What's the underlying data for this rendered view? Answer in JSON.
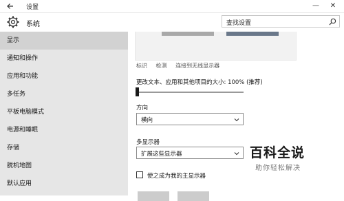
{
  "window": {
    "title": "设置"
  },
  "header": {
    "title": "系统",
    "search_placeholder": "查找设置"
  },
  "sidebar": {
    "items": [
      {
        "label": "显示",
        "selected": true
      },
      {
        "label": "通知和操作",
        "selected": false
      },
      {
        "label": "应用和功能",
        "selected": false
      },
      {
        "label": "多任务",
        "selected": false
      },
      {
        "label": "平板电脑模式",
        "selected": false
      },
      {
        "label": "电源和睡眠",
        "selected": false
      },
      {
        "label": "存储",
        "selected": false
      },
      {
        "label": "脱机地图",
        "selected": false
      },
      {
        "label": "默认应用",
        "selected": false
      }
    ]
  },
  "display": {
    "links": [
      "标识",
      "检测",
      "连接到无线显示器"
    ],
    "scale_label": "更改文本、应用和其他项目的大小: 100% (推荐)",
    "scale_percent": 100,
    "orientation_label": "方向",
    "orientation_value": "横向",
    "multi_display_label": "多显示器",
    "multi_display_value": "扩展这些显示器",
    "main_display_checkbox": "使之成为我的主显示器",
    "main_display_checked": false
  },
  "watermark": {
    "title": "百科全说",
    "subtitle": "助你轻松解决"
  },
  "colors": {
    "sidebar_bg": "#e6e6e6",
    "sidebar_selected": "#d2d2d2",
    "monitor_2": "#6a788a",
    "monitor_1": "#a9a9a9"
  }
}
